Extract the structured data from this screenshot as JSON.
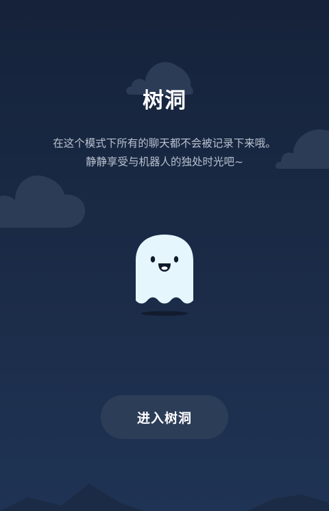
{
  "page": {
    "title": "树洞",
    "description_line1": "在这个模式下所有的聊天都不会被记录下来哦。",
    "description_line2": "静静享受与机器人的独处时光吧~",
    "enter_button_label": "进入树洞"
  },
  "icons": {
    "ghost": "ghost-icon",
    "cloud": "cloud-icon"
  },
  "colors": {
    "background_top": "#15223a",
    "background_bottom": "#1f3354",
    "cloud": "#2d3c56",
    "ghost_body": "#e6f6fd",
    "button_bg": "#2c3d58",
    "text_secondary": "#b9c1cf"
  }
}
